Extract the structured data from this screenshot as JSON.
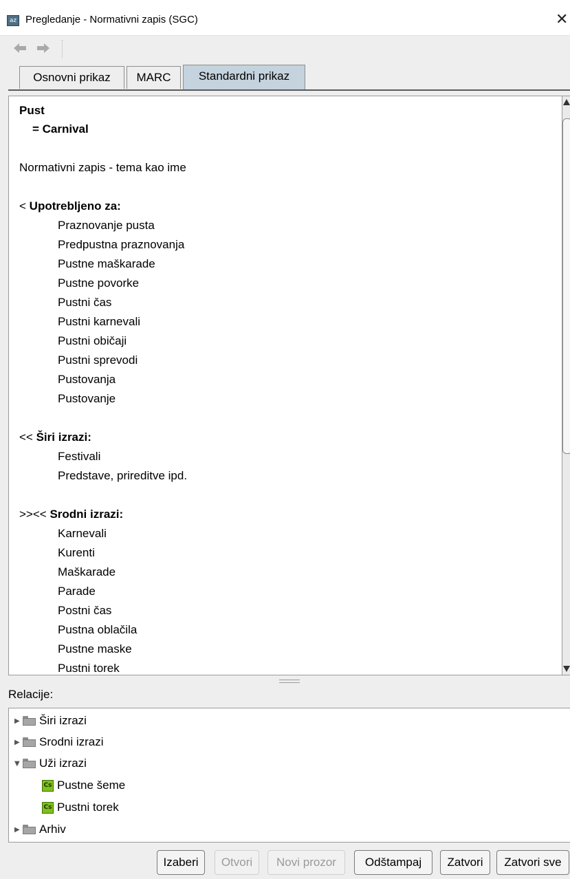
{
  "window": {
    "app_icon_text": "az",
    "title": "Pregledanje - Normativni zapis (SGC)",
    "close_label": "✕"
  },
  "toolbar": {
    "back_icon": "back-arrow-icon",
    "forward_icon": "forward-arrow-icon"
  },
  "tabs": [
    {
      "label": "Osnovni prikaz",
      "active": false
    },
    {
      "label": "MARC",
      "active": false
    },
    {
      "label": "Standardni prikaz",
      "active": true
    }
  ],
  "record": {
    "heading": "Pust",
    "parallel": "= Carnival",
    "type": "Normativni zapis - tema kao ime",
    "used_for": {
      "prefix": "<",
      "label": "Upotrebljeno za:",
      "items": [
        "Praznovanje pusta",
        "Predpustna praznovanja",
        "Pustne maškarade",
        "Pustne povorke",
        "Pustni čas",
        "Pustni karnevali",
        "Pustni običaji",
        "Pustni sprevodi",
        "Pustovanja",
        "Pustovanje"
      ]
    },
    "broader": {
      "prefix": "<<",
      "label": "Širi izrazi:",
      "items": [
        "Festivali",
        "Predstave, prireditve ipd."
      ]
    },
    "related": {
      "prefix": ">><<",
      "label": "Srodni izrazi:",
      "items": [
        "Karnevali",
        "Kurenti",
        "Maškarade",
        "Parade",
        "Postni čas",
        "Pustna oblačila",
        "Pustne maske",
        "Pustni torek"
      ]
    }
  },
  "relations": {
    "label": "Relacije:",
    "nodes": [
      {
        "label": "Širi izrazi",
        "expanded": false,
        "icon": "folder-icon"
      },
      {
        "label": "Srodni izrazi",
        "expanded": false,
        "icon": "folder-icon"
      },
      {
        "label": "Uži izrazi",
        "expanded": true,
        "icon": "folder-icon",
        "children": [
          {
            "label": "Pustne šeme",
            "icon": "cs-record-icon",
            "icon_text": "Cs"
          },
          {
            "label": "Pustni torek",
            "icon": "cs-record-icon",
            "icon_text": "Cs"
          }
        ]
      },
      {
        "label": "Arhiv",
        "expanded": false,
        "icon": "folder-icon"
      }
    ]
  },
  "buttons": {
    "select": {
      "label": "Izaberi",
      "enabled": true
    },
    "open": {
      "label": "Otvori",
      "enabled": false
    },
    "new_window": {
      "label": "Novi prozor",
      "enabled": false
    },
    "print": {
      "label": "Odštampaj",
      "enabled": true
    },
    "close": {
      "label": "Zatvori",
      "enabled": true
    },
    "close_all": {
      "label": "Zatvori sve",
      "enabled": true
    }
  },
  "colors": {
    "active_tab": "#c4d3de",
    "cs_icon": "#7fbf1d",
    "disabled_text": "#9a9a9a"
  }
}
